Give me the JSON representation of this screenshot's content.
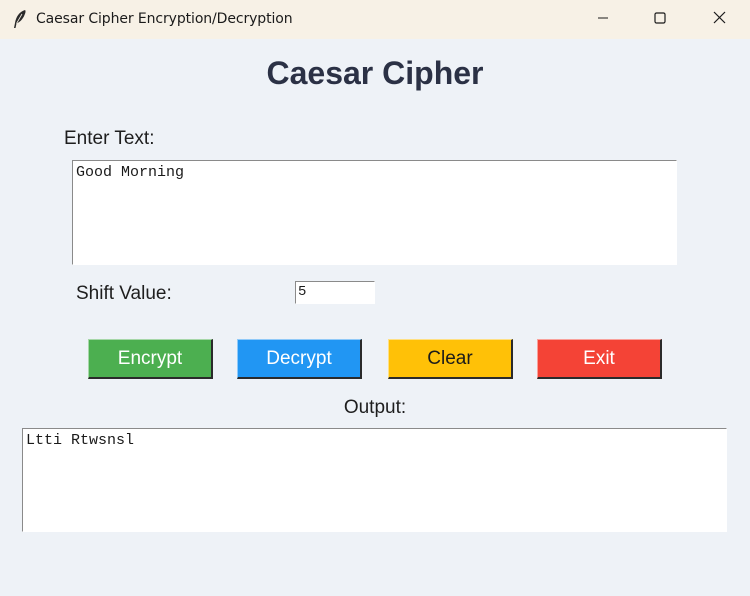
{
  "window": {
    "title": "Caesar Cipher Encryption/Decryption",
    "icon": "feather-icon",
    "controls": [
      "minimize-icon",
      "maximize-icon",
      "close-icon"
    ]
  },
  "main": {
    "heading": "Caesar Cipher",
    "enter_text_label": "Enter Text:",
    "input_value": "Good Morning",
    "shift_label": "Shift Value:",
    "shift_value": "5",
    "buttons": {
      "encrypt": "Encrypt",
      "decrypt": "Decrypt",
      "clear": "Clear",
      "exit": "Exit"
    },
    "output_label": "Output:",
    "output_value": "Ltti Rtwsnsl"
  },
  "colors": {
    "background": "#eef2f7",
    "titlebar": "#f7f1e6",
    "heading": "#2b3145",
    "encrypt": "#4caf50",
    "decrypt": "#2196f3",
    "clear": "#ffc107",
    "exit": "#f44336"
  }
}
